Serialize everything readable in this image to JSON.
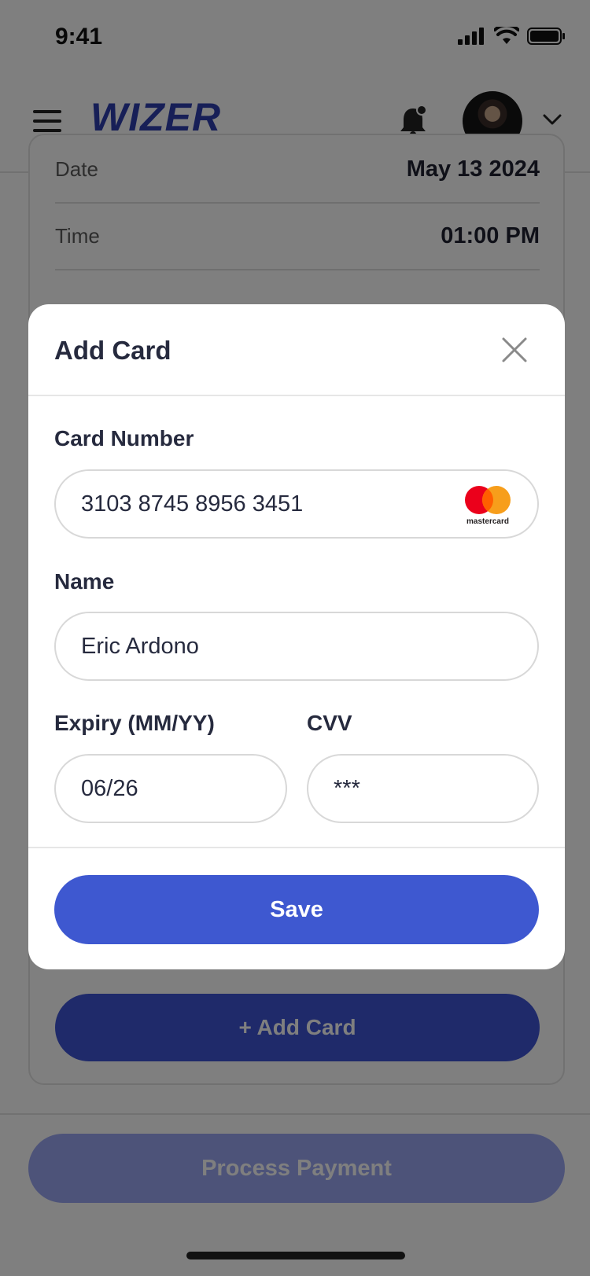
{
  "status_bar": {
    "time": "9:41"
  },
  "header": {
    "logo": "WIZER"
  },
  "details": [
    {
      "label": "Date",
      "value": "May 13 2024"
    },
    {
      "label": "Time",
      "value": "01:00 PM"
    }
  ],
  "page": {
    "add_card_label": "+ Add Card",
    "process_payment_label": "Process Payment"
  },
  "modal": {
    "title": "Add Card",
    "card_number_label": "Card Number",
    "card_number_value": "3103 8745 8956 3451",
    "card_brand": "mastercard",
    "name_label": "Name",
    "name_value": "Eric Ardono",
    "expiry_label": "Expiry (MM/YY)",
    "expiry_value": "06/26",
    "cvv_label": "CVV",
    "cvv_value": "***",
    "save_label": "Save"
  },
  "colors": {
    "primary": "#3e58d0",
    "logo": "#2f3fae",
    "mastercard_red": "#eb001b",
    "mastercard_orange": "#f79e1b"
  }
}
